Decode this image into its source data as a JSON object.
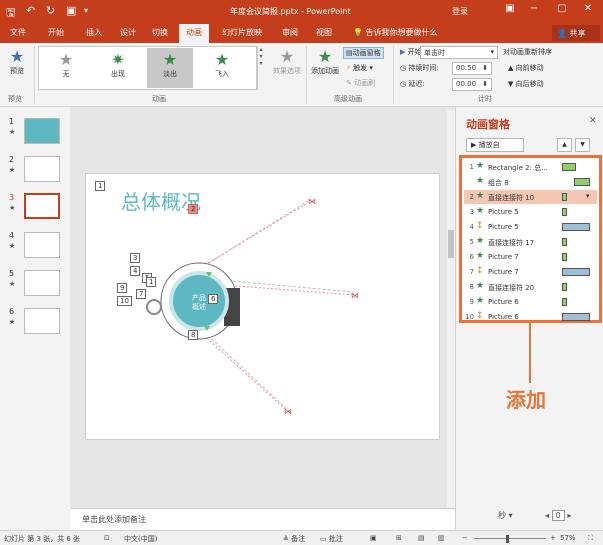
{
  "app": {
    "window_title": "年度会议简报.pptx - PowerPoint",
    "login": "登录",
    "share": "共享",
    "tell_me": "告诉我你想要做什么"
  },
  "tabs": [
    "文件",
    "开始",
    "插入",
    "设计",
    "切换",
    "动画",
    "幻灯片放映",
    "审阅",
    "视图"
  ],
  "ribbon": {
    "preview_label": "预览",
    "gallery_items": [
      "无",
      "出现",
      "淡出",
      "飞入"
    ],
    "effect_options": "效果选项",
    "add_animation": "添加动画",
    "animation_pane_btn": "动画窗格",
    "trigger": "触发",
    "anim_painter": "动画刷",
    "start_label": "开始:",
    "start_value": "单击时",
    "duration_label": "持续时间:",
    "duration_value": "00.50",
    "delay_label": "延迟:",
    "delay_value": "00.00",
    "reorder_title": "对动画重新排序",
    "move_earlier": "向前移动",
    "move_later": "向后移动",
    "groups": [
      "预览",
      "动画",
      "高级动画",
      "计时"
    ]
  },
  "thumbnails": [
    {
      "num": "1",
      "star": "★"
    },
    {
      "num": "2",
      "star": "★"
    },
    {
      "num": "3",
      "star": "★"
    },
    {
      "num": "4",
      "star": "★"
    },
    {
      "num": "5",
      "star": "★"
    },
    {
      "num": "6",
      "star": "★"
    }
  ],
  "slide": {
    "title": "总体概况",
    "center_text": "产品\n概述",
    "tags": [
      "1",
      "2",
      "3",
      "4",
      "5",
      "6",
      "7",
      "8",
      "9",
      "10",
      "1"
    ]
  },
  "notes_placeholder": "单击此处添加备注",
  "pane": {
    "title": "动画窗格",
    "play_label": "播放自",
    "items": [
      {
        "num": "1",
        "icon": "★",
        "name": "Rectangle 2: 总...",
        "color": "#8fce6a"
      },
      {
        "num": "",
        "icon": "★",
        "name": "组合 8",
        "color": "#8fce6a"
      },
      {
        "num": "2",
        "icon": "★",
        "name": "直接连接符 10",
        "color": "#8fce6a"
      },
      {
        "num": "3",
        "icon": "★",
        "name": "Picture 5",
        "color": "#8fce6a"
      },
      {
        "num": "4",
        "icon": "↕",
        "name": "Picture 5",
        "color": "#9dbfd8"
      },
      {
        "num": "5",
        "icon": "★",
        "name": "直接连接符 17",
        "color": "#8fce6a"
      },
      {
        "num": "6",
        "icon": "★",
        "name": "Picture 7",
        "color": "#8fce6a"
      },
      {
        "num": "7",
        "icon": "↕",
        "name": "Picture 7",
        "color": "#9dbfd8"
      },
      {
        "num": "8",
        "icon": "★",
        "name": "直接连接符 20",
        "color": "#8fce6a"
      },
      {
        "num": "9",
        "icon": "★",
        "name": "Picture 6",
        "color": "#8fce6a"
      },
      {
        "num": "10",
        "icon": "↕",
        "name": "Picture 6",
        "color": "#9dbfd8"
      }
    ],
    "callout": "添加",
    "seconds": "秒",
    "zoom_box": "0"
  },
  "status": {
    "slide_info": "幻灯片 第 3 张，共 6 张",
    "language": "中文(中国)",
    "notes": "备注",
    "comments": "批注",
    "zoom": "57%"
  },
  "colors": {
    "accent": "#c43e1c",
    "callout": "#e8743a"
  }
}
